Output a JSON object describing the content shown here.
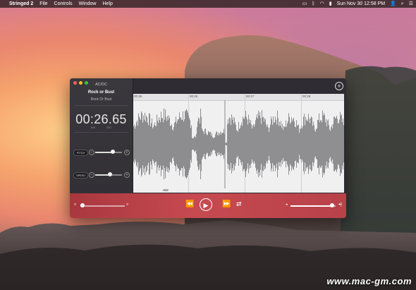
{
  "menubar": {
    "app_name": "Stringed 2",
    "menus": [
      "File",
      "Controls",
      "Window",
      "Help"
    ],
    "clock": "Sun Nov 30  12:58 PM"
  },
  "sidebar": {
    "artist": "AC/DC",
    "track": "Rock or Bust",
    "album": "Rock Or Bust",
    "time": "00:26.65",
    "time_label_left": "MIN",
    "time_label_right": "SEC",
    "pitch_label": "PITCH",
    "speed_label": "SPEED",
    "pitch_value": 0.65,
    "speed_value": 0.55
  },
  "timeline": {
    "ticks": [
      "00:25",
      "00:26",
      "00:27",
      "00:28"
    ]
  },
  "playback": {
    "zoom_value": 0.05,
    "volume_value": 0.92
  },
  "watermark": "www.mac-gm.com"
}
